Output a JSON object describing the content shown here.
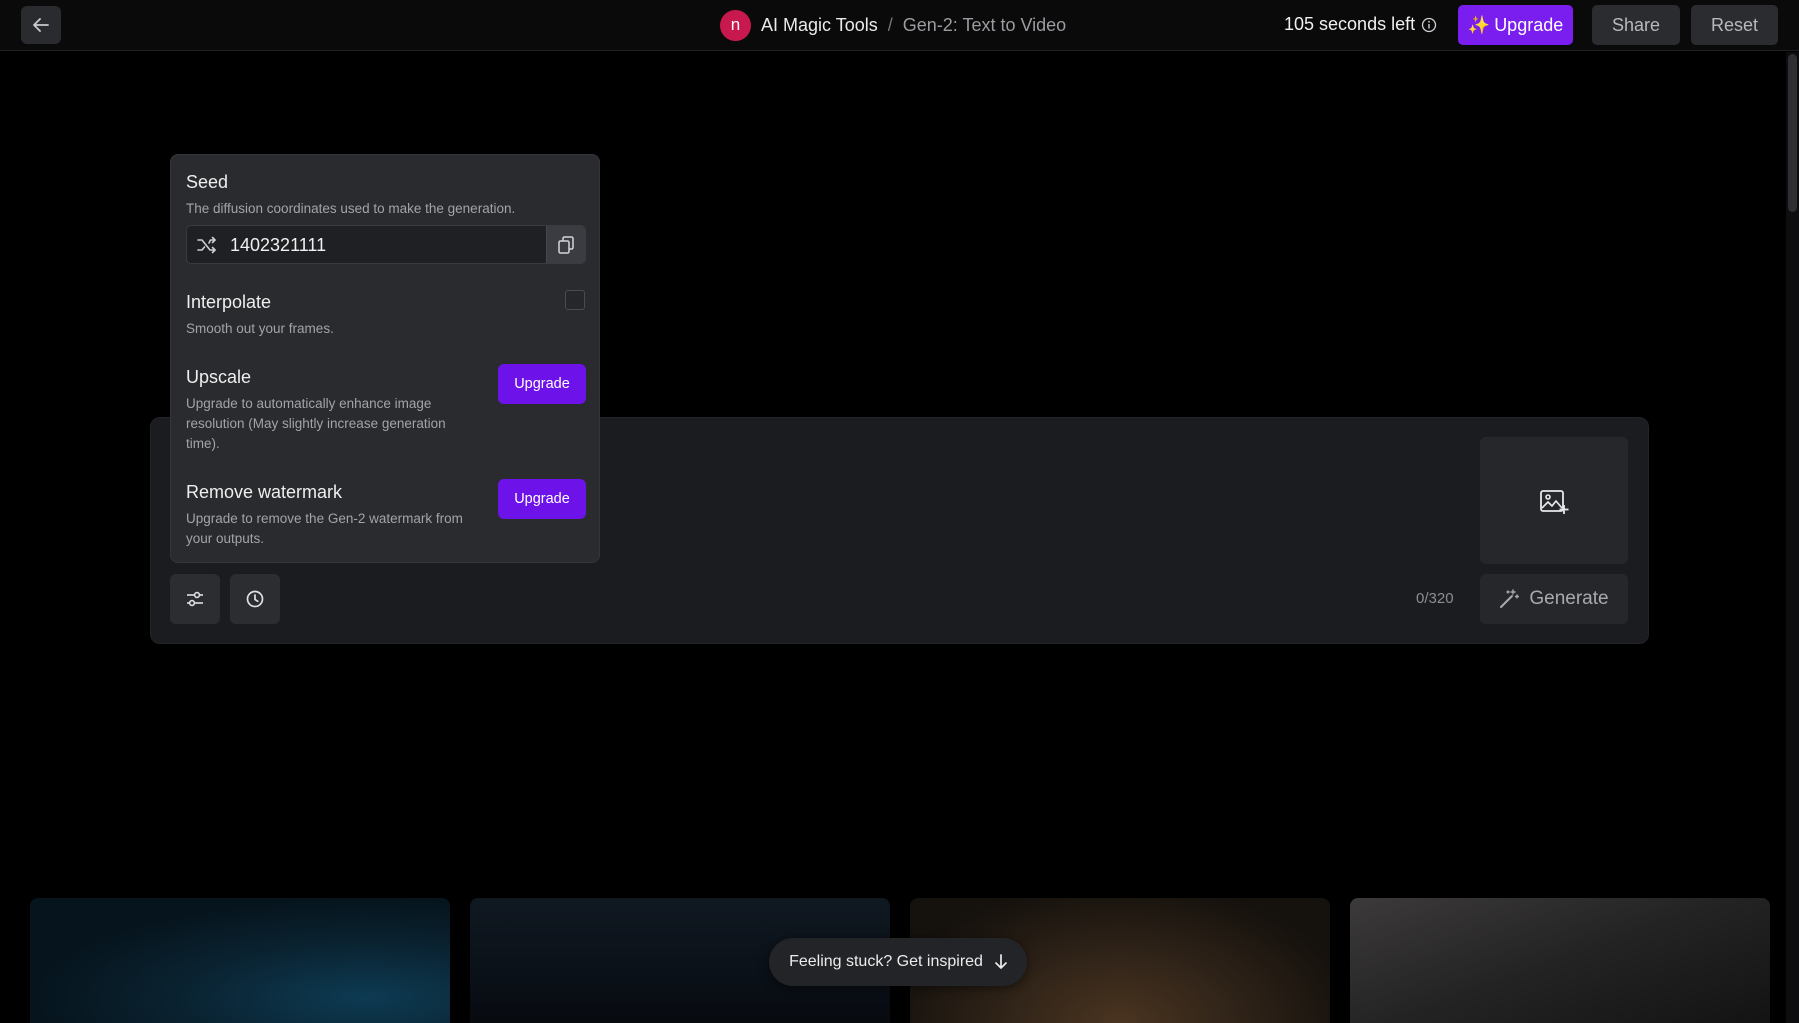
{
  "header": {
    "avatar_letter": "n",
    "app_name": "AI Magic Tools",
    "separator": "/",
    "page_name": "Gen-2: Text to Video",
    "time_left": "105 seconds left",
    "upgrade_label": "Upgrade",
    "upgrade_sparkle": "✨",
    "share_label": "Share",
    "reset_label": "Reset"
  },
  "settings": {
    "seed": {
      "title": "Seed",
      "description": "The diffusion coordinates used to make the generation.",
      "value": "1402321111"
    },
    "interpolate": {
      "title": "Interpolate",
      "description": "Smooth out your frames.",
      "checked": false
    },
    "upscale": {
      "title": "Upscale",
      "description": "Upgrade to automatically enhance image resolution (May slightly increase generation time).",
      "button_label": "Upgrade"
    },
    "watermark": {
      "title": "Remove watermark",
      "description": "Upgrade to remove the Gen-2 watermark from your outputs.",
      "button_label": "Upgrade"
    }
  },
  "prompt": {
    "char_count": "0/320",
    "generate_label": "Generate"
  },
  "inspire": {
    "label": "Feeling stuck? Get inspired"
  },
  "icons": {
    "back": "arrow-left-icon",
    "info": "info-icon",
    "shuffle": "shuffle-icon",
    "copy": "copy-icon",
    "image_add": "image-add-icon",
    "settings": "sliders-icon",
    "history": "clock-icon",
    "generate": "magic-wand-icon",
    "arrow_down": "arrow-down-icon"
  },
  "colors": {
    "accent": "#7a1ef0",
    "avatar": "#c8194f"
  }
}
